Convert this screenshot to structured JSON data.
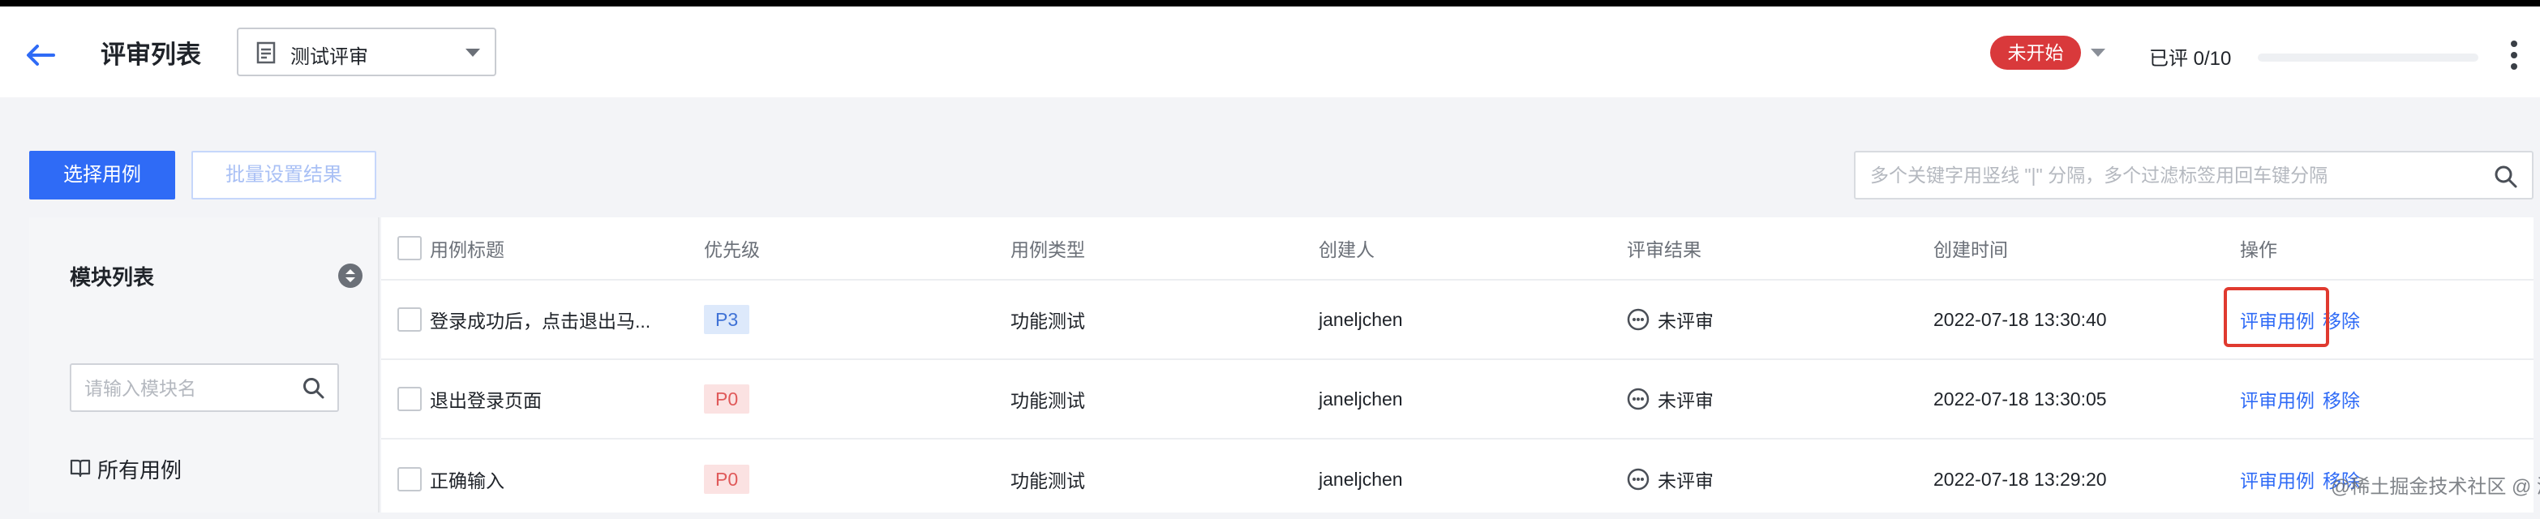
{
  "header": {
    "title": "评审列表",
    "review_select": {
      "value": "测试评审"
    },
    "status": "未开始",
    "reviewed_progress": "已评 0/10",
    "progress_fraction": 0
  },
  "toolbar": {
    "select_cases_label": "选择用例",
    "batch_set_label": "批量设置结果",
    "search_placeholder": "多个关键字用竖线 \"|\" 分隔，多个过滤标签用回车键分隔"
  },
  "sidebar": {
    "title": "模块列表",
    "search_placeholder": "请输入模块名",
    "all_cases_label": "所有用例"
  },
  "table": {
    "columns": [
      "用例标题",
      "优先级",
      "用例类型",
      "创建人",
      "评审结果",
      "创建时间",
      "操作"
    ],
    "rows": [
      {
        "title": "登录成功后，点击退出马...",
        "priority": "P3",
        "type": "功能测试",
        "creator": "janeljchen",
        "result": "未评审",
        "created": "2022-07-18 13:30:40",
        "actions": [
          "评审用例",
          "移除"
        ]
      },
      {
        "title": "退出登录页面",
        "priority": "P0",
        "type": "功能测试",
        "creator": "janeljchen",
        "result": "未评审",
        "created": "2022-07-18 13:30:05",
        "actions": [
          "评审用例",
          "移除"
        ]
      },
      {
        "title": "正确输入",
        "priority": "P0",
        "type": "功能测试",
        "creator": "janeljchen",
        "result": "未评审",
        "created": "2022-07-18 13:29:20",
        "actions": [
          "评审用例",
          "移除"
        ]
      }
    ]
  },
  "watermark": "@稀土掘金技术社区 @ 测吧",
  "colors": {
    "accent": "#2f6bf6",
    "status_red": "#d9393b",
    "highlight": "#e03a2f"
  }
}
